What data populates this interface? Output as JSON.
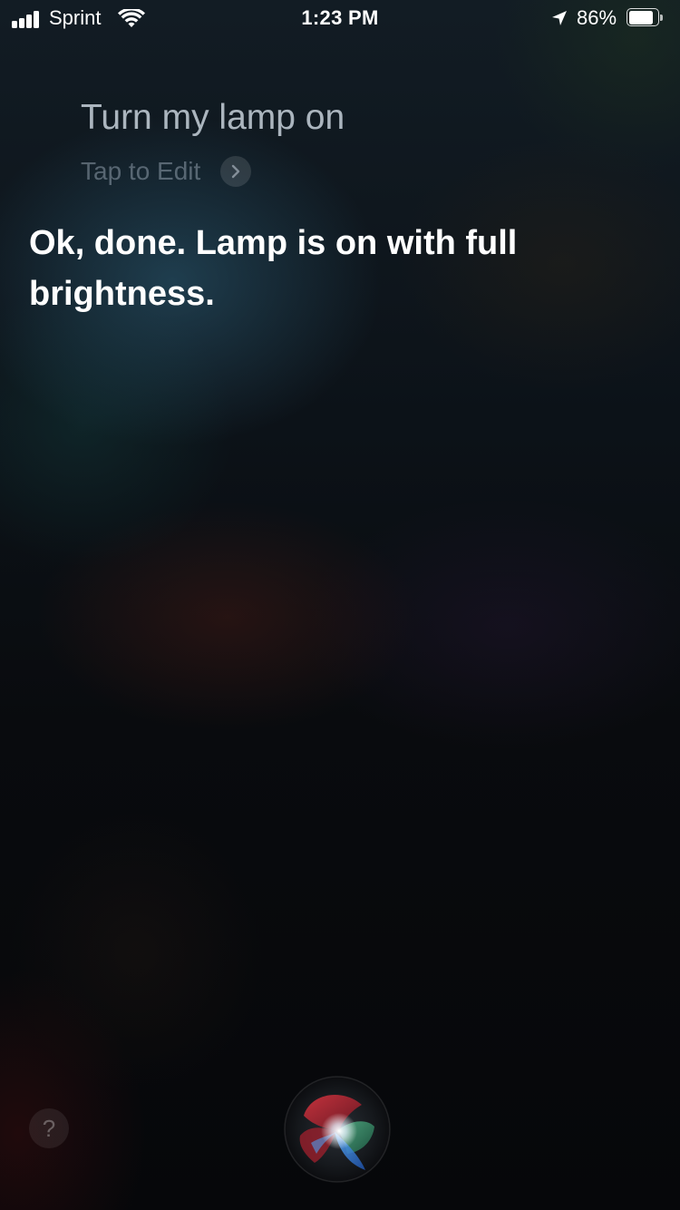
{
  "status_bar": {
    "carrier": "Sprint",
    "time": "1:23 PM",
    "battery_percent_text": "86%",
    "battery_level": 0.86,
    "signal_bars": 4,
    "icons": [
      "signal-bars-icon",
      "wifi-icon",
      "location-arrow-icon",
      "battery-icon"
    ]
  },
  "siri": {
    "user_query": "Turn my lamp on",
    "tap_to_edit_label": "Tap to Edit",
    "response": "Ok, done. Lamp is on with full brightness.",
    "help_label": "?"
  },
  "colors": {
    "background": "#07090c",
    "text_primary": "#ffffff"
  }
}
